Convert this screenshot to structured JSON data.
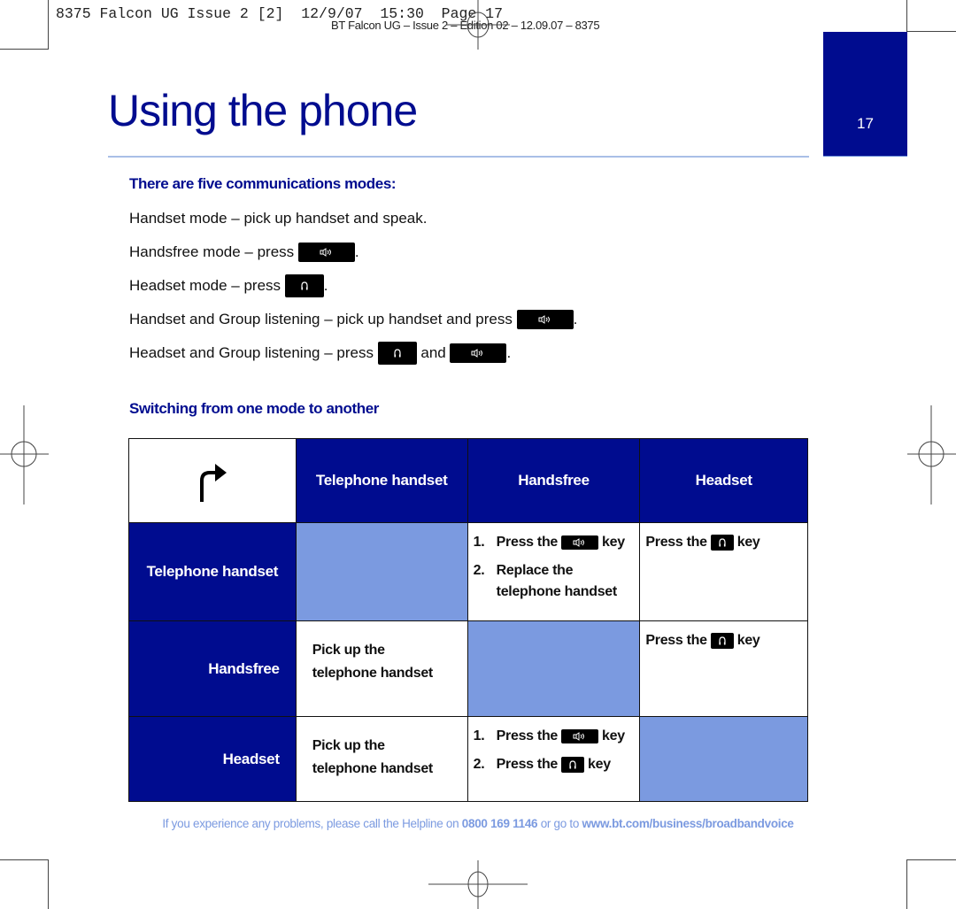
{
  "print_slug": {
    "job_line": "8375 Falcon UG Issue 2 [2]  12/9/07  15:30  Page 17",
    "edition_line": "BT Falcon UG – Issue 2 – Edition 02 – 12.09.07 – 8375"
  },
  "page": {
    "number": "17",
    "title": "Using the phone",
    "accent_color": "#000c8f",
    "light_accent_color": "#7b9ae0"
  },
  "modes_section": {
    "heading": "There are five communications modes:",
    "lines": [
      {
        "parts": [
          {
            "text": "Handset mode – pick up handset and speak."
          }
        ]
      },
      {
        "parts": [
          {
            "text": "Handsfree mode – press "
          },
          {
            "key": "speaker-icon"
          },
          {
            "text": "."
          }
        ]
      },
      {
        "parts": [
          {
            "text": "Headset mode – press "
          },
          {
            "key": "headset-icon"
          },
          {
            "text": "."
          }
        ]
      },
      {
        "parts": [
          {
            "text": "Handset and Group listening – pick up handset and press "
          },
          {
            "key": "speaker-icon"
          },
          {
            "text": "."
          }
        ]
      },
      {
        "parts": [
          {
            "text": "Headset and Group listening – press "
          },
          {
            "key": "headset-icon"
          },
          {
            "text": " and "
          },
          {
            "key": "speaker-icon"
          },
          {
            "text": "."
          }
        ]
      }
    ]
  },
  "switching_section": {
    "heading": "Switching from one mode to another",
    "corner_icon": "turn-right-arrow-icon",
    "column_headers": [
      "Telephone handset",
      "Handsfree",
      "Headset"
    ],
    "rows": [
      {
        "label": "Telephone handset",
        "cells": [
          {
            "type": "same"
          },
          {
            "type": "steps",
            "steps": [
              {
                "n": "1.",
                "parts": [
                  {
                    "text": "Press the"
                  },
                  {
                    "key": "speaker-icon"
                  },
                  {
                    "text": "key"
                  }
                ]
              },
              {
                "n": "2.",
                "parts": [
                  {
                    "text": "Replace the telephone handset"
                  }
                ]
              }
            ]
          },
          {
            "type": "single",
            "parts": [
              {
                "text": "Press the"
              },
              {
                "key": "headset-icon"
              },
              {
                "text": "key"
              }
            ]
          }
        ]
      },
      {
        "label": "Handsfree",
        "cells": [
          {
            "type": "text",
            "text": "Pick up the telephone handset"
          },
          {
            "type": "same"
          },
          {
            "type": "single",
            "parts": [
              {
                "text": "Press the"
              },
              {
                "key": "headset-icon"
              },
              {
                "text": "key"
              }
            ]
          }
        ]
      },
      {
        "label": "Headset",
        "cells": [
          {
            "type": "text",
            "text": "Pick up the telephone handset"
          },
          {
            "type": "steps",
            "steps": [
              {
                "n": "1.",
                "parts": [
                  {
                    "text": "Press the"
                  },
                  {
                    "key": "speaker-icon"
                  },
                  {
                    "text": "key"
                  }
                ]
              },
              {
                "n": "2.",
                "parts": [
                  {
                    "text": "Press the"
                  },
                  {
                    "key": "headset-icon"
                  },
                  {
                    "text": "key"
                  }
                ]
              }
            ]
          },
          {
            "type": "same"
          }
        ]
      }
    ]
  },
  "footer": {
    "prefix": "If you experience any problems, please call the Helpline on ",
    "phone": "0800 169 1146",
    "middle": " or go to ",
    "url": "www.bt.com/business/broadbandvoice"
  }
}
